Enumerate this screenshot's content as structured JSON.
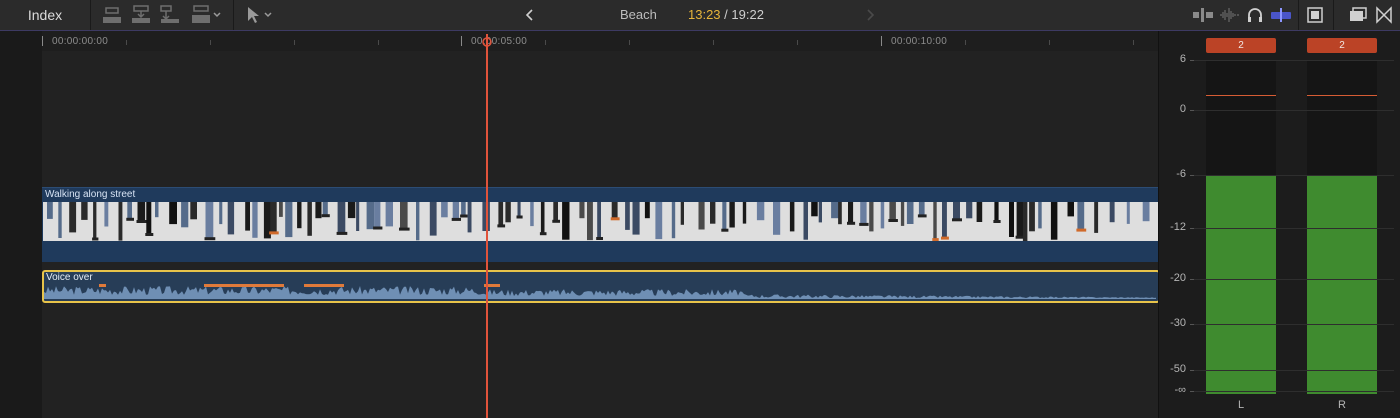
{
  "toolbar": {
    "index_label": "Index",
    "project_name": "Beach",
    "current_time": "13:23",
    "separator": " / ",
    "total_time": "19:22",
    "icons_left": [
      "append-clip-icon",
      "insert-clip-icon",
      "connect-clip-icon",
      "overwrite-clip-icon",
      "select-tool-icon"
    ],
    "icons_right": [
      "audio-skimming-icon",
      "skimming-icon",
      "headphones-icon",
      "snapping-icon",
      "clip-appearance-icon",
      "timeline-layout-icon",
      "effects-browser-icon"
    ]
  },
  "ruler": {
    "labels": [
      "00:00:00:00",
      "00:00:05:00",
      "00:00:10:00"
    ]
  },
  "timeline": {
    "video_clip_name": "Walking along street",
    "audio_clip_name": "Voice over",
    "playhead_position": "00:00:05:00"
  },
  "meters": {
    "scale": [
      "6",
      "0",
      "-6",
      "-12",
      "-20",
      "-30",
      "-50",
      "-∞"
    ],
    "channels": [
      {
        "name": "L",
        "peak": "2",
        "level_db": -6
      },
      {
        "name": "R",
        "peak": "2",
        "level_db": -6
      }
    ]
  },
  "colors": {
    "accent_yellow": "#e7b53a",
    "playhead": "#e0533b",
    "video_clip": "#1f3a5c",
    "audio_selection": "#e7c34a",
    "meter_green": "#3f8b2f",
    "peak_badge": "#bb4326"
  }
}
